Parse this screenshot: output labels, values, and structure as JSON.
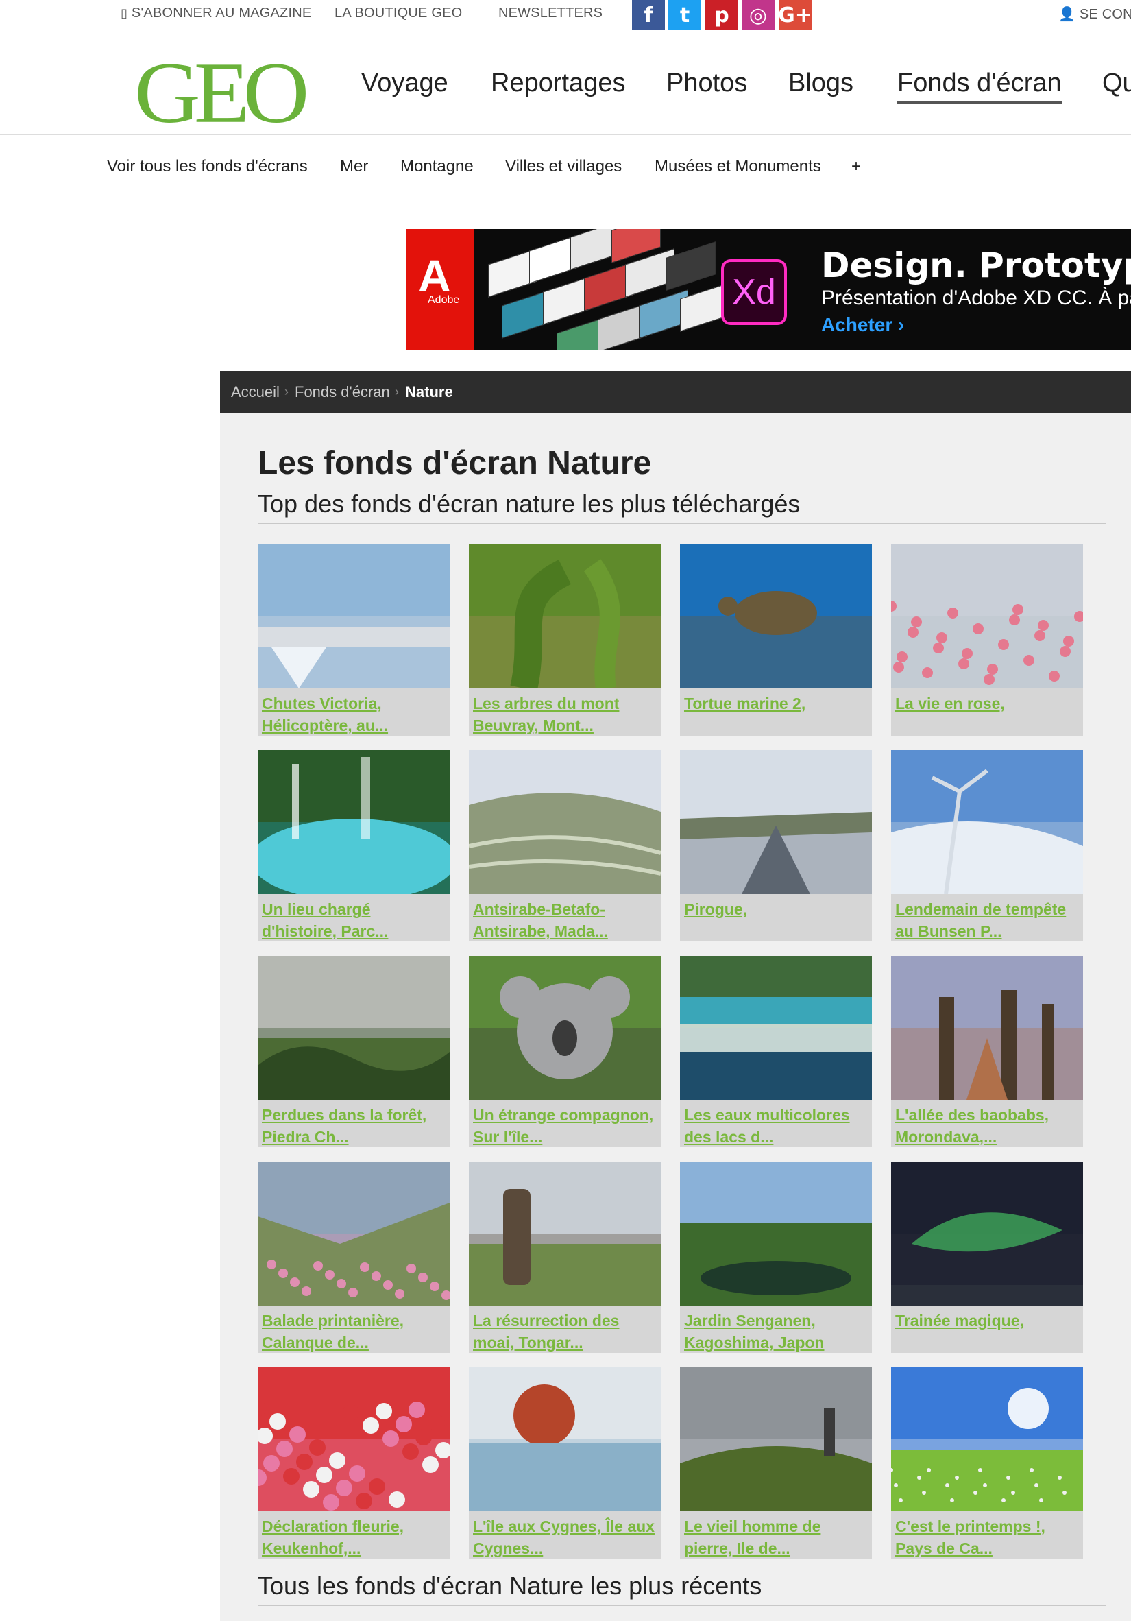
{
  "topbar": {
    "subscribe": "S'ABONNER AU MAGAZINE",
    "shop": "LA BOUTIQUE GEO",
    "newsletters": "NEWSLETTERS",
    "login": "SE CON",
    "social": [
      {
        "name": "facebook",
        "glyph": "f",
        "color": "#3b5998"
      },
      {
        "name": "twitter",
        "glyph": "t",
        "color": "#1da1f2"
      },
      {
        "name": "pinterest",
        "glyph": "p",
        "color": "#cb2027"
      },
      {
        "name": "instagram",
        "glyph": "◎",
        "color": "#c1358b"
      },
      {
        "name": "googleplus",
        "glyph": "G+",
        "color": "#dd4b39"
      }
    ]
  },
  "header": {
    "logo": "GEO",
    "nav": [
      "Voyage",
      "Reportages",
      "Photos",
      "Blogs",
      "Fonds d'écran",
      "Qu"
    ],
    "active": "Fonds d'écran"
  },
  "subnav": [
    "Voir tous les fonds d'écrans",
    "Mer",
    "Montagne",
    "Villes et villages",
    "Musées et Monuments",
    "+"
  ],
  "ad": {
    "brand": "Adobe",
    "product": "Xd",
    "headline": "Design. Prototype. Ex",
    "subline": "Présentation d'Adobe XD CC. À part",
    "cta": "Acheter ›"
  },
  "breadcrumb": [
    "Accueil",
    "Fonds d'écran",
    "Nature"
  ],
  "page": {
    "title": "Les fonds d'écran Nature",
    "subtitle": "Top des fonds d'écran nature les plus téléchargés",
    "recent_title": "Tous les fonds d'écran Nature les plus récents"
  },
  "cards": [
    {
      "caption": "Chutes Victoria, Hélicoptère, au...",
      "scene": "waterfall",
      "colors": [
        "#8fb6d8",
        "#4e6b3c",
        "#d9dde2"
      ]
    },
    {
      "caption": "Les arbres du mont Beuvray, Mont...",
      "scene": "forest",
      "colors": [
        "#5f8a2b",
        "#93b84a",
        "#a98a5a"
      ]
    },
    {
      "caption": "Tortue marine 2,",
      "scene": "turtle",
      "colors": [
        "#1b6fb8",
        "#0b3f7a",
        "#6a5a3a"
      ]
    },
    {
      "caption": "La vie en rose,",
      "scene": "flamingo",
      "colors": [
        "#c9cfd8",
        "#e59aa9",
        "#b8c3cc"
      ]
    },
    {
      "caption": "Un lieu chargé d'histoire, Parc...",
      "scene": "lagoon",
      "colors": [
        "#2a5a2a",
        "#4fc9d6",
        "#1a9bb0"
      ]
    },
    {
      "caption": "Antsirabe-Betafo-Antsirabe, Mada...",
      "scene": "terraces",
      "colors": [
        "#d9dfe8",
        "#8e9a7b",
        "#6b7f35"
      ]
    },
    {
      "caption": "Pirogue,",
      "scene": "river",
      "colors": [
        "#d6dde6",
        "#6f7b62",
        "#5c6570"
      ]
    },
    {
      "caption": "Lendemain de tempête au Bunsen P...",
      "scene": "snow",
      "colors": [
        "#5b8fd1",
        "#e8eef5",
        "#c9d4df"
      ]
    },
    {
      "caption": "Perdues dans la forêt, Piedra Ch...",
      "scene": "fog",
      "colors": [
        "#b5b8b2",
        "#4c6b34",
        "#2e4a22"
      ]
    },
    {
      "caption": "Un étrange compagnon, Sur l'île...",
      "scene": "koala",
      "colors": [
        "#5c8a3a",
        "#a3a4a6",
        "#3a3a3a"
      ]
    },
    {
      "caption": "Les eaux multicolores des lacs d...",
      "scene": "cascade",
      "colors": [
        "#3f6a3a",
        "#3aa6b8",
        "#1e4d6a"
      ]
    },
    {
      "caption": "L'allée des baobabs, Morondava,...",
      "scene": "baobab",
      "colors": [
        "#9a9fc0",
        "#e8b7b0",
        "#b0704a"
      ]
    },
    {
      "caption": "Balade printanière, Calanque de...",
      "scene": "calanque",
      "colors": [
        "#8fa3b8",
        "#7a8d5a",
        "#e08fb2"
      ]
    },
    {
      "caption": "La résurrection des moai, Tongar...",
      "scene": "moai",
      "colors": [
        "#c7cdd3",
        "#6f8a4a",
        "#5a4a3a"
      ]
    },
    {
      "caption": "Jardin Senganen, Kagoshima, Japon",
      "scene": "garden",
      "colors": [
        "#8ab1d8",
        "#3d6a2d",
        "#1e3a2a"
      ]
    },
    {
      "caption": "Trainée magique,",
      "scene": "aurora",
      "colors": [
        "#1c2030",
        "#3fa85a",
        "#2a2f3a"
      ]
    },
    {
      "caption": "Déclaration fleurie, Keukenhof,...",
      "scene": "tulips",
      "colors": [
        "#d9363a",
        "#f2f2f2",
        "#e87aa5"
      ]
    },
    {
      "caption": "L'île aux Cygnes, Île aux Cygnes...",
      "scene": "island",
      "colors": [
        "#dfe5ea",
        "#b5452a",
        "#8ab0c8"
      ]
    },
    {
      "caption": "Le vieil homme de pierre, Ile de...",
      "scene": "storr",
      "colors": [
        "#8e9398",
        "#4f6a2a",
        "#c8ccd0"
      ]
    },
    {
      "caption": "C'est le printemps !, Pays de Ca...",
      "scene": "spring",
      "colors": [
        "#3a7ad8",
        "#7cbc3a",
        "#f0f0f0"
      ]
    }
  ]
}
